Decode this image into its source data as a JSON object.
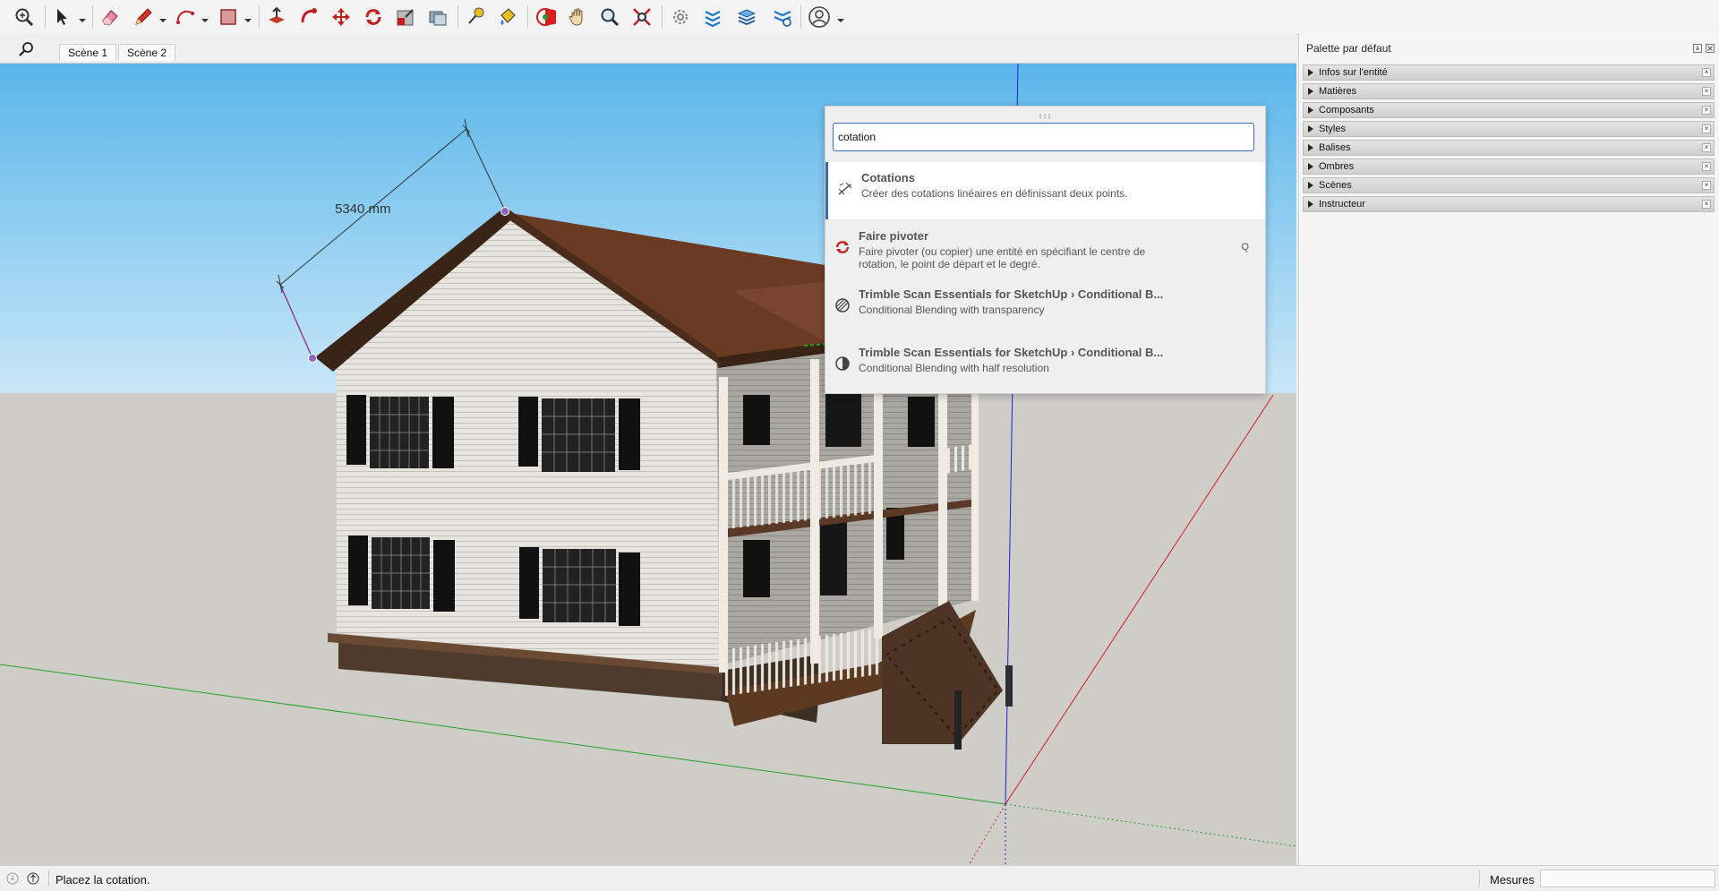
{
  "toolbar": {
    "icons": [
      "zoom-extents-icon",
      "select-icon",
      "eraser-icon",
      "pencil-icon",
      "arc-icon",
      "rectangle-icon",
      "push-pull-icon",
      "follow-me-icon",
      "move-icon",
      "rotate-icon",
      "scale-icon",
      "offset-icon",
      "tape-measure-icon",
      "paint-bucket-icon",
      "orbit-icon",
      "pan-icon",
      "zoom-icon",
      "zoom-window-icon",
      "trimble-scan-icon",
      "layers-icon",
      "stack-icon",
      "scan-settings-icon",
      "user-account-icon"
    ]
  },
  "scenes": {
    "tabs": [
      "Scène 1",
      "Scène 2"
    ]
  },
  "viewport": {
    "dimension_label": "5340 mm"
  },
  "command_search": {
    "query": "cotation",
    "results": [
      {
        "title": "Cotations",
        "description": "Créer des cotations linéaires en définissant deux points.",
        "shortcut": "",
        "icon": "dimension-icon"
      },
      {
        "title": "Faire pivoter",
        "description": "Faire pivoter (ou copier) une entité en spécifiant le centre de rotation, le point de départ et le degré.",
        "shortcut": "Q",
        "icon": "rotate-icon"
      },
      {
        "title": "Trimble Scan Essentials for SketchUp › Conditional B...",
        "description": "Conditional Blending with transparency",
        "shortcut": "",
        "icon": "transparency-icon"
      },
      {
        "title": "Trimble Scan Essentials for SketchUp › Conditional B...",
        "description": "Conditional Blending with half resolution",
        "shortcut": "",
        "icon": "half-resolution-icon"
      }
    ]
  },
  "tray": {
    "title": "Palette par défaut",
    "panels": [
      "Infos sur l'entité",
      "Matières",
      "Composants",
      "Styles",
      "Balises",
      "Ombres",
      "Scènes",
      "Instructeur"
    ]
  },
  "status": {
    "message": "Placez la cotation.",
    "measurements_label": "Mesures",
    "measurements_value": ""
  },
  "colors": {
    "sky_top": "#5ab6ea",
    "sky_bottom": "#c9e7f8",
    "ground": "#cfcdc8",
    "accent": "#3b6db3",
    "roof": "#6b3a22"
  }
}
